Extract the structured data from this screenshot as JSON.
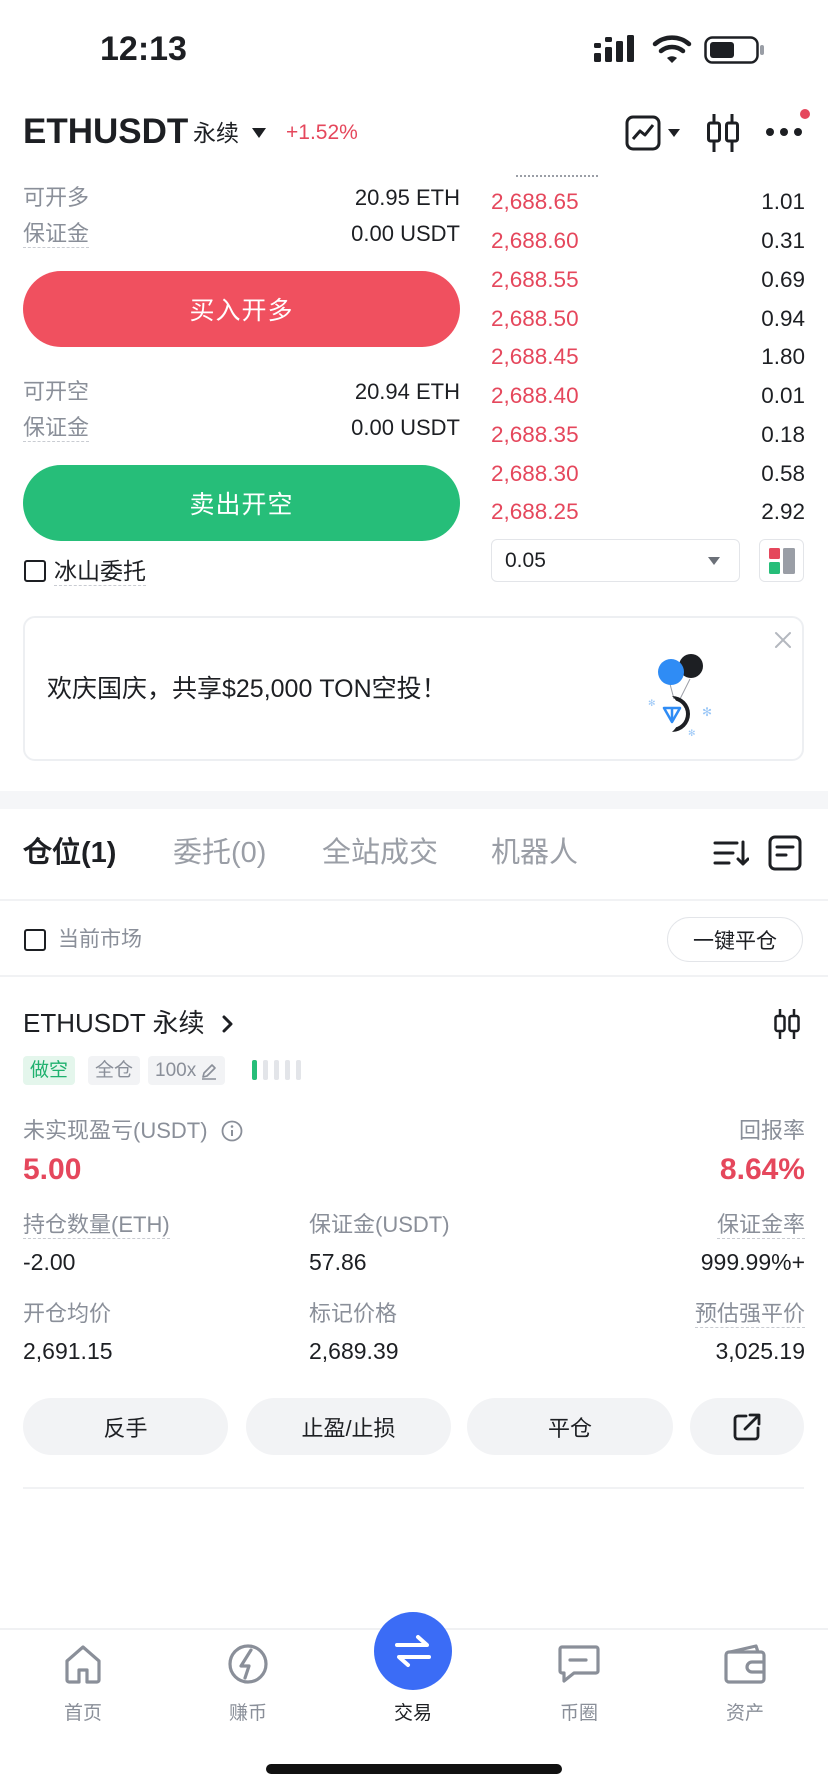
{
  "status_bar": {
    "time": "12:13"
  },
  "header": {
    "symbol": "ETHUSDT",
    "contract": "永续",
    "change": "+1.52%"
  },
  "long": {
    "available_label": "可开多",
    "available_value": "20.95 ETH",
    "margin_label": "保证金",
    "margin_value": "0.00 USDT",
    "button": "买入开多"
  },
  "short": {
    "available_label": "可开空",
    "available_value": "20.94 ETH",
    "margin_label": "保证金",
    "margin_value": "0.00 USDT",
    "button": "卖出开空"
  },
  "iceberg": {
    "label": "冰山委托",
    "checked": false
  },
  "orderbook": {
    "asks": [
      {
        "price": "2,688.65",
        "qty": "1.01"
      },
      {
        "price": "2,688.60",
        "qty": "0.31"
      },
      {
        "price": "2,688.55",
        "qty": "0.69"
      },
      {
        "price": "2,688.50",
        "qty": "0.94"
      },
      {
        "price": "2,688.45",
        "qty": "1.80"
      },
      {
        "price": "2,688.40",
        "qty": "0.01"
      },
      {
        "price": "2,688.35",
        "qty": "0.18"
      },
      {
        "price": "2,688.30",
        "qty": "0.58"
      },
      {
        "price": "2,688.25",
        "qty": "2.92"
      }
    ],
    "precision": "0.05"
  },
  "banner": {
    "text": "欢庆国庆，共享$25,000 TON空投！"
  },
  "tabs": [
    {
      "label": "仓位(1)",
      "active": true
    },
    {
      "label": "委托(0)"
    },
    {
      "label": "全站成交"
    },
    {
      "label": "机器人"
    }
  ],
  "filter": {
    "current_market": "当前市场",
    "close_all": "一键平仓"
  },
  "position": {
    "symbol": "ETHUSDT",
    "contract": "永续",
    "side": "做空",
    "margin_mode": "全仓",
    "leverage": "100x",
    "unrealized_pnl_label": "未实现盈亏(USDT)",
    "unrealized_pnl": "5.00",
    "roe_label": "回报率",
    "roe": "8.64%",
    "size_label": "持仓数量(ETH)",
    "size": "-2.00",
    "margin_label": "保证金(USDT)",
    "margin": "57.86",
    "margin_ratio_label": "保证金率",
    "margin_ratio": "999.99%+",
    "entry_label": "开仓均价",
    "entry": "2,691.15",
    "mark_label": "标记价格",
    "mark": "2,689.39",
    "liq_label": "预估强平价",
    "liq": "3,025.19",
    "actions": {
      "reverse": "反手",
      "tpsl": "止盈/止损",
      "close": "平仓"
    }
  },
  "nav": {
    "items": [
      {
        "label": "首页",
        "icon": "home-icon"
      },
      {
        "label": "赚币",
        "icon": "earn-icon"
      },
      {
        "label": "交易",
        "icon": "swap-icon",
        "active": true
      },
      {
        "label": "币圈",
        "icon": "chat-icon"
      },
      {
        "label": "资产",
        "icon": "wallet-icon"
      }
    ]
  },
  "colors": {
    "buy": "#F0505F",
    "sell": "#26BE79",
    "price_red": "#E5475C",
    "accent_blue": "#3B6CF6"
  }
}
